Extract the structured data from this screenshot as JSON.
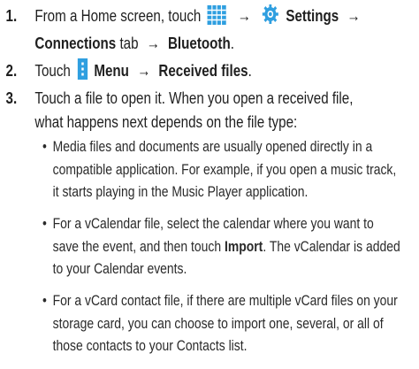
{
  "steps": [
    {
      "number": "1.",
      "line1_before": "From a Home screen, touch",
      "arrow": "→",
      "settings_label": "Settings",
      "connections_label": "Connections",
      "tab_word": "tab",
      "bluetooth_label": "Bluetooth",
      "icons": [
        "apps-grid-icon",
        "gear-icon"
      ]
    },
    {
      "number": "2.",
      "before": "Touch",
      "menu_label": "Menu",
      "received_label": "Received files",
      "icons": [
        "menu-icon"
      ]
    },
    {
      "number": "3.",
      "line1": "Touch a file to open it. When you open a received file,",
      "line2": "what happens next depends on the file type:"
    }
  ],
  "bullets": [
    {
      "lines": [
        "Media files and documents are usually opened directly in a",
        "compatible application. For example, if you open a music track,",
        "it starts playing in the Music Player application."
      ]
    },
    {
      "line1": "For a vCalendar file, select the calendar where you want to",
      "line2_before": "save the event, and then touch",
      "import_label": "Import",
      "line2_after": ". The vCalendar is added",
      "line3": "to your Calendar events."
    },
    {
      "lines": [
        "For a vCard contact file, if there are multiple vCard files on your",
        "storage card, you can choose to import one, several, or all of",
        "those contacts to your Contacts list."
      ]
    }
  ],
  "bullet_char": "•",
  "colors": {
    "icon_blue": "#2f9fe0",
    "text": "#1f1f1f"
  }
}
